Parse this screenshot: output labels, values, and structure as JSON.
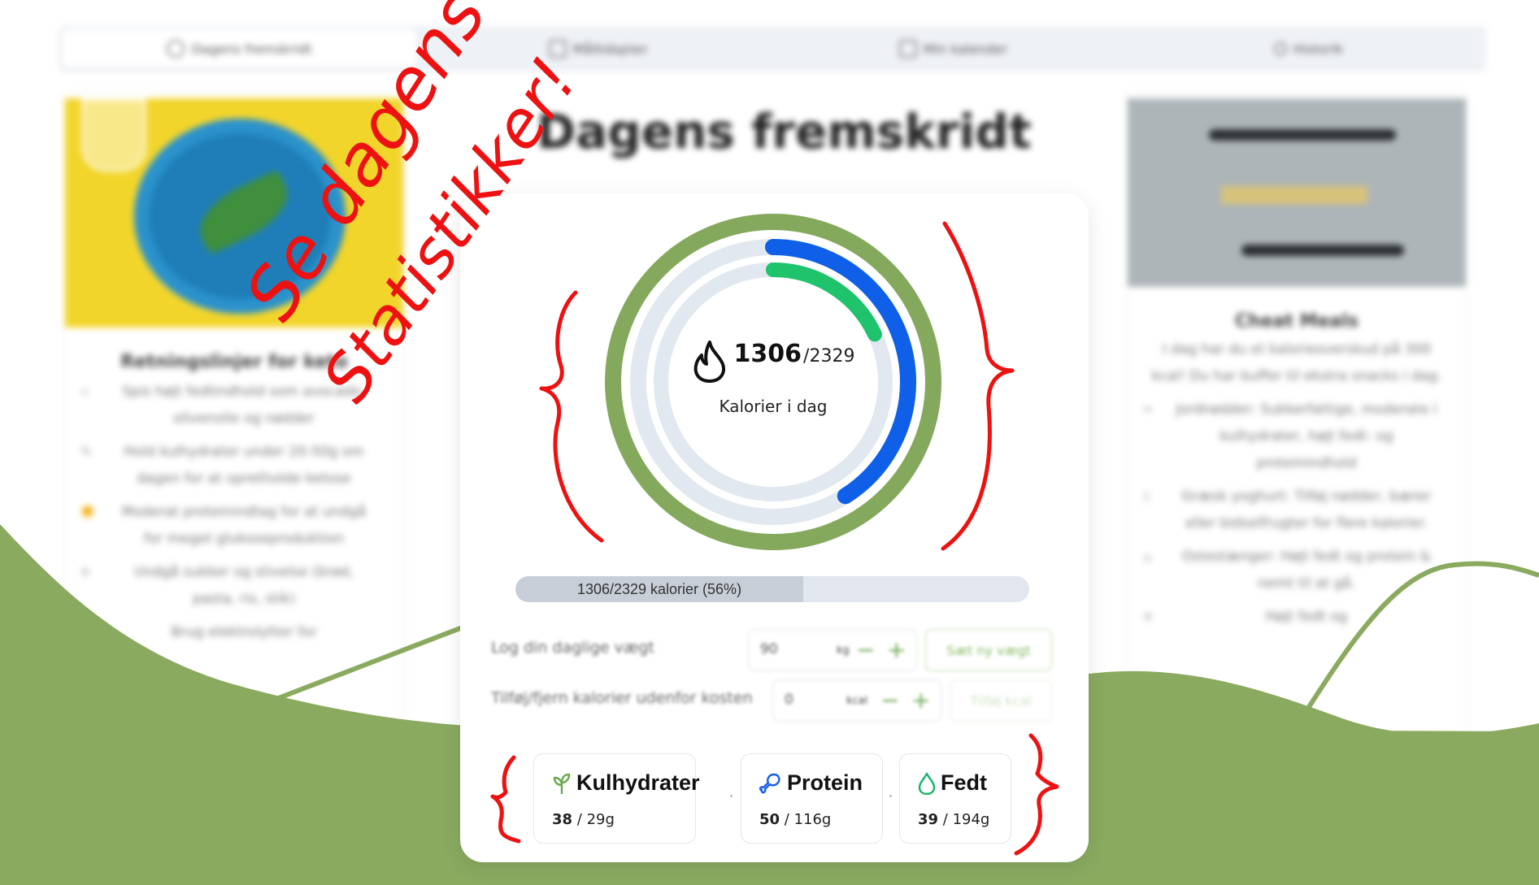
{
  "colors": {
    "brand_green": "#8aaa60",
    "outer_ring": "#84a85c",
    "blue_arc": "#0f5fe8",
    "green_arc": "#1ec36b",
    "annotation_red": "#ee1111"
  },
  "tabs": [
    {
      "label": "Dagens fremskridt",
      "icon": "progress-icon",
      "active": true
    },
    {
      "label": "Måltidsplan",
      "icon": "calendar-icon",
      "active": false
    },
    {
      "label": "Min kalender",
      "icon": "calendar-grid-icon",
      "active": false
    },
    {
      "label": "Historik",
      "icon": "history-icon",
      "active": false
    }
  ],
  "page_title": "Dagens fremskridt",
  "left_card": {
    "title": "Retningslinjer for keto",
    "items": [
      {
        "icon": "drop-icon",
        "text": "Spis højt fedtindhold som avocado, olivenolie og nødder"
      },
      {
        "icon": "percent-icon",
        "text": "Hold kulhydrater under 20-50g om dagen for at opretholde ketose"
      },
      {
        "icon": "muscle-icon",
        "text": "Moderat proteinindtag for at undgå for meget glukoseproduktion"
      },
      {
        "icon": "no-icon",
        "text": "Undgå sukker og stivelse (brød, pasta, ris, stik)"
      },
      {
        "icon": "bulb-icon",
        "text": "Brug elektrolytter for"
      }
    ]
  },
  "right_card": {
    "title": "Cheat Meals",
    "intro": "I dag har du et kalorieoverskud på 300 kcal! Du har buffer til ekstra snacks i dag.",
    "items": [
      {
        "icon": "arrow-icon",
        "text": "Jordnødder: Sukkerfattige, moderate i kulhydrater, højt fedt- og proteinindhold"
      },
      {
        "icon": "cup-icon",
        "text": "Græsk yoghurt: Tilføj nødder, bærer eller bidselfrugter for flere kalorier."
      },
      {
        "icon": "cheese-icon",
        "text": "Ostestænger: Højt fedt og protein & nemt til at gå."
      },
      {
        "icon": "sticks-icon",
        "text": "Højt fedt og"
      }
    ]
  },
  "calories": {
    "consumed": 1306,
    "goal": 2329,
    "goal_text": "/2329",
    "label": "Kalorier i dag",
    "outer_fraction": 1.0,
    "blue_fraction": 0.41,
    "green_fraction": 0.18
  },
  "progress": {
    "text": "1306/2329 kalorier (56%)",
    "fraction": 0.56
  },
  "weight_log": {
    "label": "Log din daglige vægt",
    "value": "90",
    "unit": "kg",
    "button": "Sæt ny vægt"
  },
  "calorie_adjust": {
    "label": "Tilføj/fjern kalorier udenfor kosten",
    "value": "0",
    "unit": "kcal",
    "button": "Tilføj kcal"
  },
  "macros": [
    {
      "name": "Kulhydrater",
      "icon": "sprout-icon",
      "current": "38",
      "goal": " / 29g",
      "color": "#6aa84f"
    },
    {
      "name": "Protein",
      "icon": "drumstick-icon",
      "current": "50",
      "goal": " / 116g",
      "color": "#1560e8"
    },
    {
      "name": "Fedt",
      "icon": "droplet-icon",
      "current": "39",
      "goal": " / 194g",
      "color": "#16b36a"
    }
  ],
  "annotation": {
    "line1": "Se dagens",
    "line2": "Statistikker!"
  }
}
